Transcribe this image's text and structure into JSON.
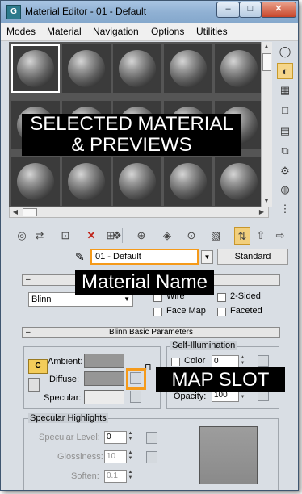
{
  "window": {
    "title": "Material Editor - 01 - Default",
    "app_icon_glyph": "G",
    "controls": {
      "minimize": "–",
      "maximize": "□",
      "close": "✕"
    }
  },
  "menu": [
    "Modes",
    "Material",
    "Navigation",
    "Options",
    "Utilities"
  ],
  "sample_slots": {
    "rows": 3,
    "columns": 5,
    "selected_index": 0
  },
  "side_toolbar": [
    "sample-type-sphere",
    "backlight",
    "background-checker",
    "sample-uv-tiling",
    "video-color-check",
    "make-preview",
    "material-options",
    "select-by-material",
    "material-map-navigator"
  ],
  "toolbar": [
    "get-material",
    "put-to-scene",
    "assign-to-selection",
    "reset-map",
    "make-unique",
    "put-to-library",
    "material-id-channel",
    "show-shaded-in-viewport",
    "show-end-result",
    "go-to-parent",
    "go-forward-to-sibling"
  ],
  "material": {
    "name": "01 - Default",
    "type_button": "Standard"
  },
  "shader_basic": {
    "rollout_symbol": "–",
    "shader": "Blinn",
    "options": [
      "Wire",
      "2-Sided",
      "Face Map",
      "Faceted"
    ]
  },
  "blinn": {
    "rollout_symbol": "–",
    "title": "Blinn Basic Parameters",
    "ambient_label": "Ambient:",
    "diffuse_label": "Diffuse:",
    "specular_label": "Specular:",
    "ambient_lock": "C",
    "self_illum": {
      "title": "Self-Illumination",
      "color_label": "Color",
      "color_value": "0",
      "opacity_label": "Opacity:",
      "opacity_value": "100"
    }
  },
  "specular_highlights": {
    "title": "Specular Highlights",
    "level_label": "Specular Level:",
    "level_value": "0",
    "gloss_label": "Glossiness:",
    "gloss_value": "10",
    "soften_label": "Soften:",
    "soften_value": "0.1"
  },
  "annotations": {
    "selected_material_line1": "SELECTED MATERIAL",
    "selected_material_line2": "& PREVIEWS",
    "material_name": "Material Name",
    "map_slot": "MAP SLOT"
  },
  "colors": {
    "highlight_orange": "#f59a1a",
    "panel_bg": "#c9ced4",
    "slot_bg": "#3b3b3b",
    "callout_bg": "#000000"
  }
}
